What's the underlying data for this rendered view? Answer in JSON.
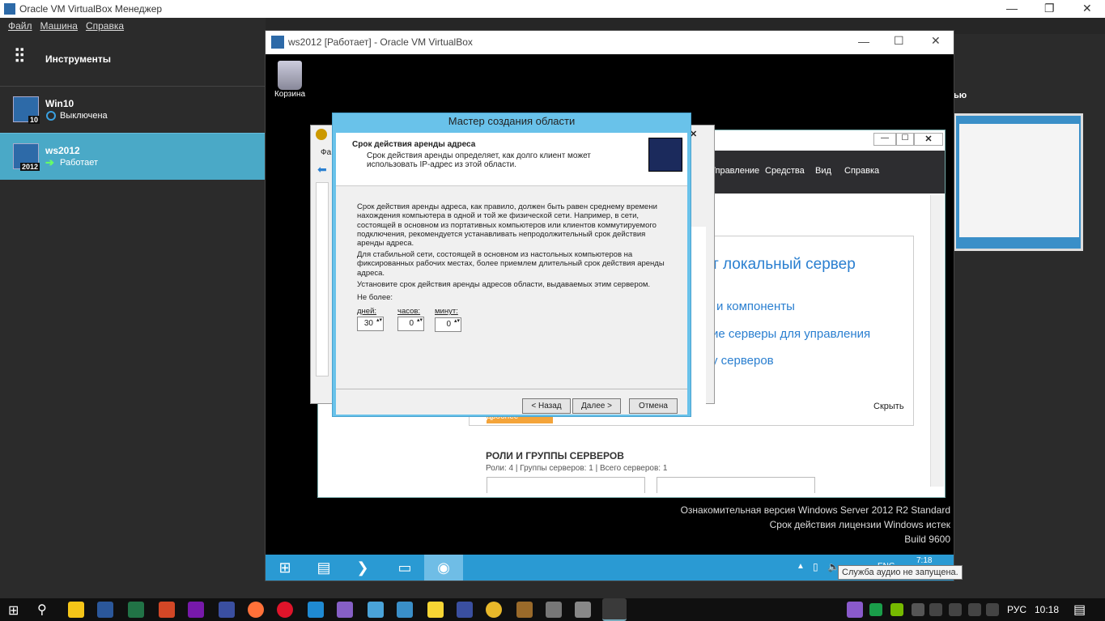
{
  "host": {
    "title": "Oracle VM VirtualBox Менеджер",
    "menu": [
      "Файл",
      "Машина",
      "Справка"
    ],
    "tools_label": "Инструменты",
    "vms": [
      {
        "name": "Win10",
        "status": "Выключена",
        "badge": "10"
      },
      {
        "name": "ws2012",
        "status": "Работает",
        "badge": "2012"
      }
    ],
    "right_fragment": "ью"
  },
  "guest": {
    "title": "ws2012 [Работает] - Oracle VM VirtualBox",
    "trash": "Корзина",
    "watermark": [
      "Ознакомительная версия Windows Server 2012 R2 Standard",
      "Срок действия лицензии Windows истек",
      "Build 9600"
    ],
    "clock": "7:18",
    "tray_text": "ENG",
    "tooltip": "Служба аудио не запущена."
  },
  "servermanager": {
    "menu": [
      "Управление",
      "Средства",
      "Вид",
      "Справка"
    ],
    "links": [
      "т локальный сервер",
      "и компоненты",
      "ие серверы для управления",
      "у серверов"
    ],
    "hide": "Скрыть",
    "section_title": "РОЛИ И ГРУППЫ СЕРВЕРОВ",
    "section_sub": "Роли: 4 | Группы серверов: 1 | Всего серверов: 1",
    "orange_fragment": "дробнее"
  },
  "dhcp": {
    "menu_fragment": "Фа"
  },
  "wizard": {
    "title": "Мастер создания области",
    "heading": "Срок действия аренды адреса",
    "subheading": "Срок действия аренды определяет, как долго клиент может использовать IP-адрес из этой области.",
    "p1": "Срок действия аренды адреса, как правило, должен быть равен среднему времени нахождения компьютера в одной и той же физической сети. Например, в сети, состоящей в основном из портативных компьютеров или клиентов коммутируемого подключения, рекомендуется устанавливать непродолжительный срок действия аренды адреса.",
    "p2": "Для стабильной сети, состоящей в основном из настольных компьютеров на фиксированных рабочих местах, более приемлем длительный срок действия аренды адреса.",
    "p3": "Установите срок действия аренды адресов области, выдаваемых этим сервером.",
    "limit": "Не более:",
    "days_label": "дней:",
    "days": "30",
    "hours_label": "часов:",
    "hours": "0",
    "minutes_label": "минут:",
    "minutes": "0",
    "back": "< Назад",
    "next": "Далее >",
    "cancel": "Отмена"
  },
  "taskbar": {
    "lang": "РУС",
    "time": "10:18"
  }
}
